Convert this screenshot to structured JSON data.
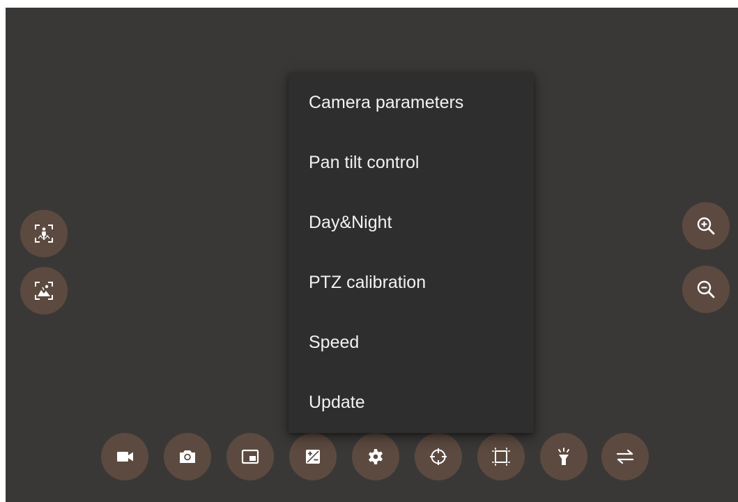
{
  "menu": {
    "items": [
      {
        "label": "Camera parameters"
      },
      {
        "label": "Pan tilt control"
      },
      {
        "label": "Day&Night"
      },
      {
        "label": "PTZ calibration"
      },
      {
        "label": "Speed"
      },
      {
        "label": "Update"
      }
    ]
  },
  "left_controls": [
    {
      "icon": "person-focus-icon"
    },
    {
      "icon": "landscape-focus-icon"
    }
  ],
  "right_controls": [
    {
      "icon": "zoom-in-icon"
    },
    {
      "icon": "zoom-out-icon"
    }
  ],
  "toolbar": {
    "buttons": [
      {
        "icon": "video-camera-icon"
      },
      {
        "icon": "photo-camera-icon"
      },
      {
        "icon": "picture-in-picture-icon"
      },
      {
        "icon": "exposure-icon"
      },
      {
        "icon": "settings-gear-icon"
      },
      {
        "icon": "crosshair-target-icon"
      },
      {
        "icon": "crop-frame-icon"
      },
      {
        "icon": "flashlight-icon"
      },
      {
        "icon": "swap-arrows-icon"
      }
    ]
  },
  "colors": {
    "background": "#3a3837",
    "button": "#5c4a40",
    "menu": "#2e2e2e",
    "text": "#f2f2f2"
  }
}
